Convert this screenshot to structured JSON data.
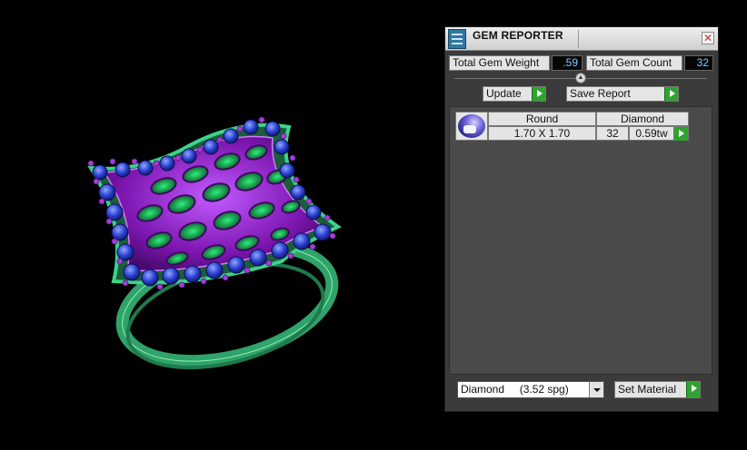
{
  "viewport": {
    "object": "ring-3d-model",
    "colors": {
      "band": "#2fa36a",
      "metal": "#8a23b8",
      "stones": "#2a3fd0",
      "background": "#000000"
    }
  },
  "panel": {
    "title": "GEM REPORTER",
    "close_glyph": "✕",
    "total_gem_weight_label": "Total Gem Weight",
    "total_gem_weight_value": ".59",
    "total_gem_count_label": "Total Gem Count",
    "total_gem_count_value": "32",
    "update_label": "Update",
    "save_report_label": "Save Report",
    "report": {
      "rows": [
        {
          "shape": "Round",
          "material": "Diamond",
          "size": "1.70 X 1.70",
          "count": "32",
          "weight": "0.59tw"
        }
      ]
    },
    "material_select": "Diamond     (3.52 spg)",
    "set_material_label": "Set Material"
  }
}
